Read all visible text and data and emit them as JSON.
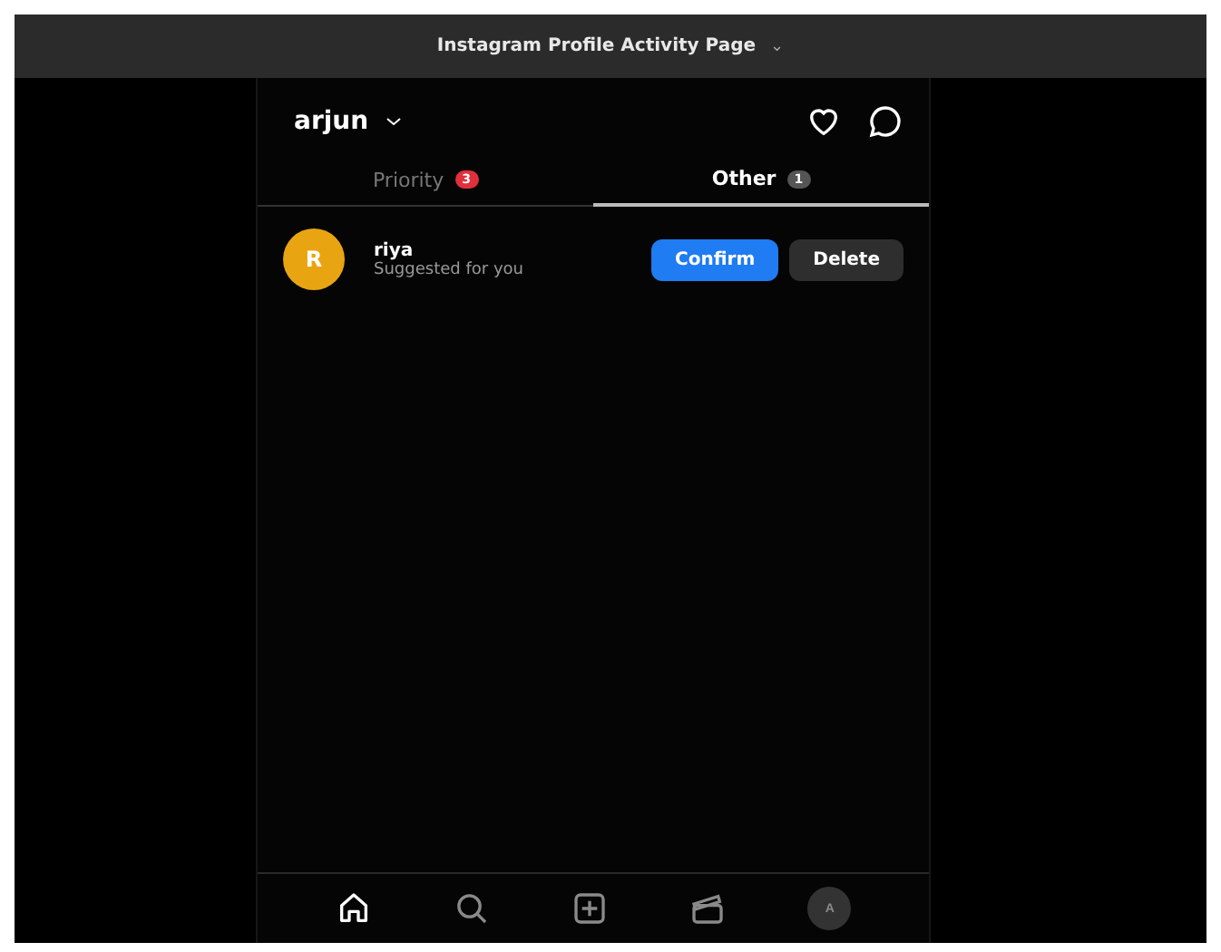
{
  "window": {
    "title": "Instagram Profile Activity Page",
    "caret": "⌄"
  },
  "header": {
    "username": "arjun"
  },
  "tabs": [
    {
      "label": "Priority",
      "badge": "3",
      "selected": false
    },
    {
      "label": "Other",
      "badge": "1",
      "selected": true
    }
  ],
  "requests": [
    {
      "avatar_letter": "R",
      "name": "riya",
      "subtitle": "Suggested for you",
      "confirm": "Confirm",
      "delete": "Delete"
    }
  ],
  "nav": [
    {
      "kind": "home",
      "selected": true
    },
    {
      "kind": "search",
      "selected": false
    },
    {
      "kind": "create",
      "selected": false
    },
    {
      "kind": "reels",
      "selected": false
    },
    {
      "kind": "profile",
      "letter": "A",
      "selected": false
    }
  ]
}
